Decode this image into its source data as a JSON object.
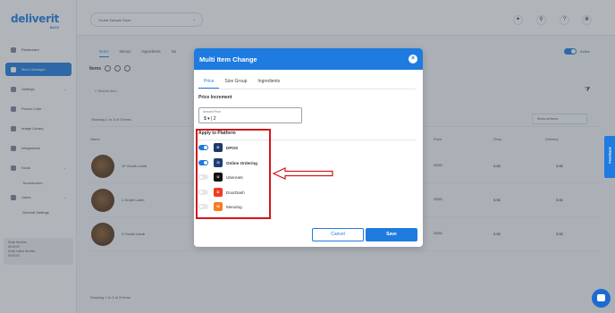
{
  "sidebar": {
    "logo": "deliverit",
    "logo_sub": "BACK",
    "items": [
      {
        "label": "Restaurant",
        "active": false
      },
      {
        "label": "Menu Manager",
        "active": true
      },
      {
        "label": "Settings",
        "active": false
      },
      {
        "label": "Promo Code",
        "active": false
      },
      {
        "label": "Image Library",
        "active": false
      },
      {
        "label": "Integrations",
        "active": false
      },
      {
        "label": "Kiosk",
        "active": false
      },
      {
        "label": "Users",
        "active": false
      }
    ],
    "sub_items": [
      "Touchscreen",
      "General Settings"
    ],
    "footer_lines": [
      "Kiosk Number",
      "00:00:00",
      "Kiosk Latest Number",
      "00:00:00"
    ]
  },
  "topbar": {
    "store": "Grubb Sample Store"
  },
  "content": {
    "tabs": [
      "Items",
      "Menus",
      "Ingredients",
      "Sa"
    ],
    "items_heading": "Items",
    "active_label": "Active",
    "search_placeholder": "Search item",
    "showing": "Showing 1 to 3 of 3 items",
    "show_filter": "Show all items",
    "columns": [
      "Name",
      "Price",
      "Shop",
      "Delivery"
    ],
    "rows": [
      {
        "name": "1P Grubb Lamb",
        "c1": "$$$$$",
        "c2": "$.$$",
        "c3": "$.$$"
      },
      {
        "name": "L Grubb Lamb",
        "c1": "$$$$$",
        "c2": "$.$$",
        "c3": "$.$$"
      },
      {
        "name": "S Grubb Lamb",
        "c1": "$$$$$",
        "c2": "$.$$",
        "c3": "$.$$"
      }
    ],
    "showing_bottom": "Showing 1 to 3 of 3 items"
  },
  "feedback_label": "Feedback",
  "modal": {
    "title": "Multi Item Change",
    "close_glyph": "×",
    "tabs": [
      "Price",
      "Size Group",
      "Ingredients"
    ],
    "price_increment_title": "Price Increment",
    "amount_label": "Amount Price",
    "amount_value": "$ ▾ | 2",
    "apply_title": "Apply to Platform",
    "platforms": [
      {
        "name": "DPOS",
        "on": true,
        "icon": "dpos-icon",
        "color": "#1b3a6b",
        "glyph": "D",
        "bold": true
      },
      {
        "name": "Online Ordering",
        "on": true,
        "icon": "online-ordering-icon",
        "color": "#1e3f73",
        "glyph": "O",
        "bold": true
      },
      {
        "name": "Ubereats",
        "on": false,
        "icon": "ubereats-icon",
        "color": "#111111",
        "glyph": "U",
        "bold": false
      },
      {
        "name": "DoorDash",
        "on": false,
        "icon": "doordash-icon",
        "color": "#ef3b24",
        "glyph": "D",
        "bold": false
      },
      {
        "name": "Menulog",
        "on": false,
        "icon": "menulog-icon",
        "color": "#f57c1f",
        "glyph": "M",
        "bold": false
      }
    ],
    "cancel_label": "Cancel",
    "save_label": "Save"
  },
  "colors": {
    "accent": "#1e7be0",
    "annotation": "#d0161c"
  }
}
